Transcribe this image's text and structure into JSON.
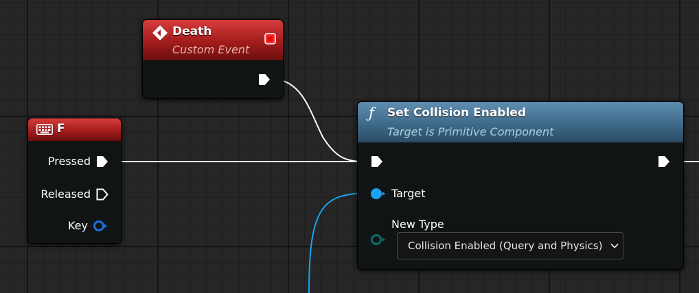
{
  "nodes": {
    "death": {
      "title": "Death",
      "subtitle": "Custom Event"
    },
    "key_f": {
      "title": "F",
      "pins": {
        "pressed": "Pressed",
        "released": "Released",
        "key": "Key"
      }
    },
    "set_collision": {
      "title": "Set Collision Enabled",
      "subtitle": "Target is Primitive Component",
      "pins": {
        "target": "Target",
        "new_type": "New Type"
      },
      "new_type_value": "Collision Enabled (Query and Physics)"
    }
  },
  "colors": {
    "event_header": "#a31c1c",
    "function_header": "#3e6a8a",
    "exec_wire": "#ffffff",
    "object_pin": "#1aa3f0",
    "struct_key_pin": "#1a6fd6",
    "enum_pin": "#0a6d6d"
  },
  "icons": {
    "death_node": "custom-event-icon",
    "death_close": "delegate-square-icon",
    "key_node": "keyboard-icon",
    "function_node": "function-icon"
  }
}
